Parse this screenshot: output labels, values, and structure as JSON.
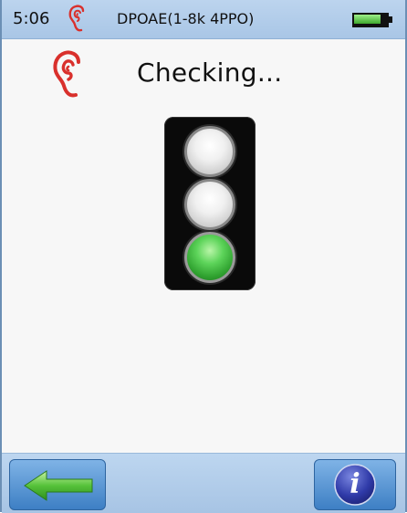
{
  "status_bar": {
    "time": "5:06",
    "ear_icon": "ear-icon",
    "mode": "DPOAE(1-8k 4PPO)",
    "battery_level": 0.85
  },
  "header": {
    "ear_icon": "ear-icon",
    "status_text": "Checking..."
  },
  "traffic_light": {
    "lamps": [
      {
        "position": "top",
        "state": "off"
      },
      {
        "position": "middle",
        "state": "off"
      },
      {
        "position": "bottom",
        "state": "on",
        "color": "#3fbf3a"
      }
    ]
  },
  "bottom_bar": {
    "back_icon": "back-arrow-icon",
    "info_icon": "info-icon",
    "info_glyph": "i"
  },
  "colors": {
    "bar_blue": "#b2cdea",
    "ear_red": "#d9302c",
    "lamp_green": "#3fbf3a",
    "arrow_green": "#3fae2a"
  }
}
